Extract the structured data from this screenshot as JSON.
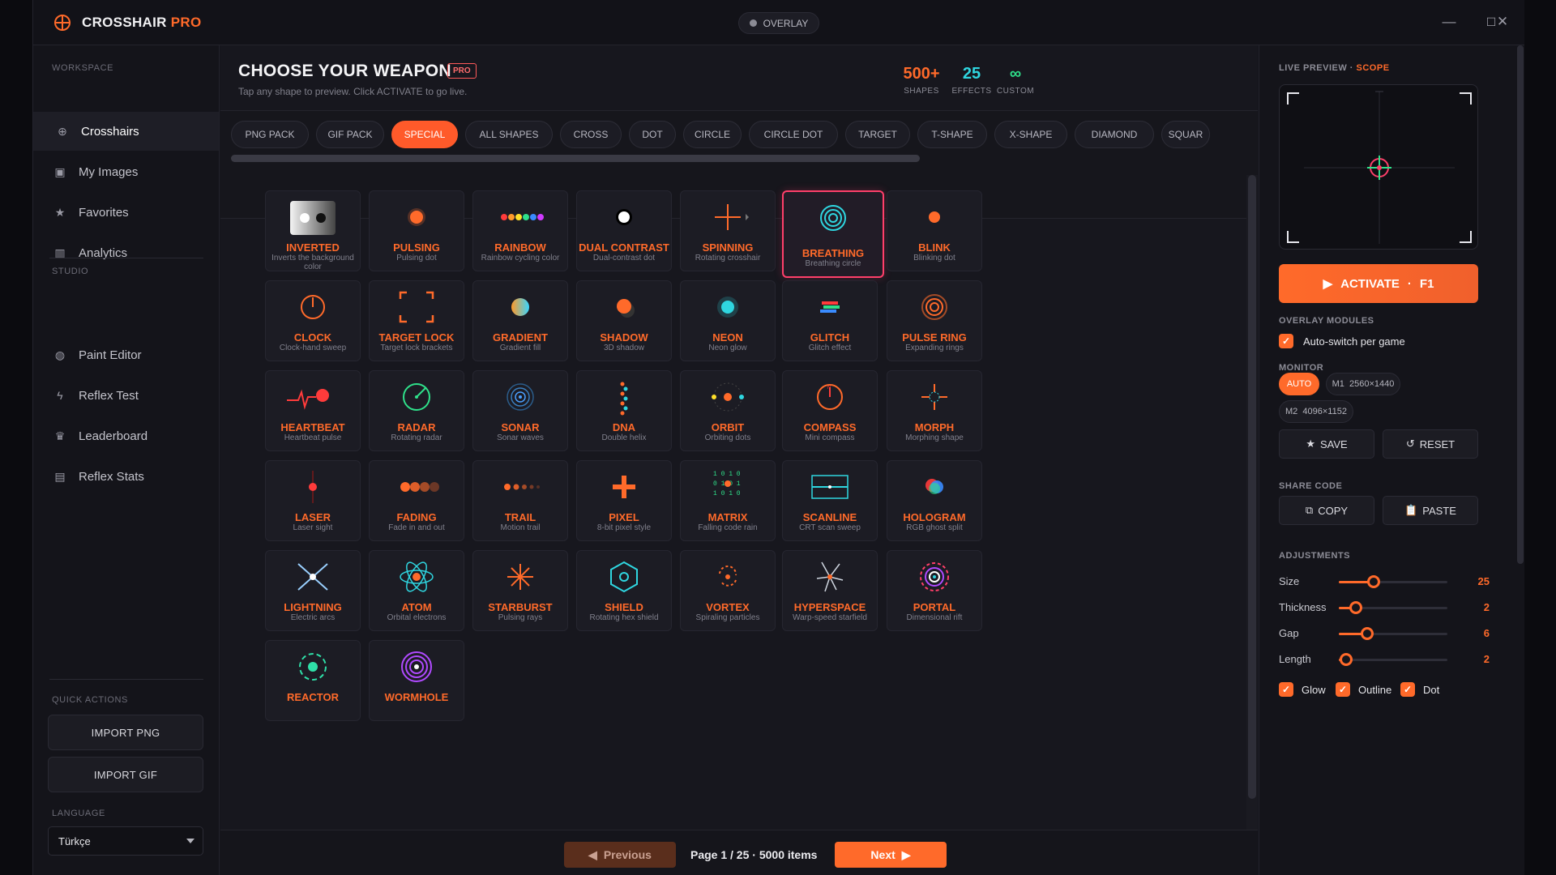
{
  "app": {
    "name": "CROSSHAIR",
    "name_accent": "PRO",
    "overlay_label": "OVERLAY"
  },
  "window_controls": {
    "minimize": "—",
    "maximize": "☐",
    "close": "✕"
  },
  "sidebar": {
    "workspace_label": "WORKSPACE",
    "studio_label": "STUDIO",
    "quick_actions_label": "QUICK ACTIONS",
    "language_label": "LANGUAGE",
    "items": [
      {
        "label": "Crosshairs",
        "icon": "crosshair-icon",
        "active": true
      },
      {
        "label": "My Images",
        "icon": "images-icon"
      },
      {
        "label": "Favorites",
        "icon": "star-icon"
      },
      {
        "label": "Analytics",
        "icon": "chart-icon"
      },
      {
        "label": "Paint Editor",
        "icon": "palette-icon"
      },
      {
        "label": "Reflex Test",
        "icon": "bolt-icon"
      },
      {
        "label": "Leaderboard",
        "icon": "trophy-icon"
      },
      {
        "label": "Reflex Stats",
        "icon": "stats-icon"
      }
    ],
    "import_png": "IMPORT PNG",
    "import_gif": "IMPORT GIF",
    "language": "Türkçe"
  },
  "main": {
    "title": "CHOOSE YOUR WEAPON",
    "badge": "PRO",
    "subtitle": "Tap any shape to preview. Click ACTIVATE to go live.",
    "stats": [
      {
        "num": "500+",
        "label": "SHAPES",
        "color": "#ff6a2a"
      },
      {
        "num": "25",
        "label": "EFFECTS",
        "color": "#2fd6e0"
      },
      {
        "num": "∞",
        "label": "CUSTOM",
        "color": "#2fe08a"
      }
    ],
    "tabs": [
      "PNG PACK",
      "GIF PACK",
      "SPECIAL",
      "ALL SHAPES",
      "CROSS",
      "DOT",
      "CIRCLE",
      "CIRCLE DOT",
      "TARGET",
      "T-SHAPE",
      "X-SHAPE",
      "DIAMOND",
      "SQUAR"
    ],
    "active_tab": "SPECIAL",
    "cards": [
      {
        "name": "INVERTED",
        "desc": "Inverts the background color",
        "icon": "inverted-icon"
      },
      {
        "name": "PULSING",
        "desc": "Pulsing dot",
        "icon": "pulse-dot-icon"
      },
      {
        "name": "RAINBOW",
        "desc": "Rainbow cycling color",
        "icon": "rainbow-dots-icon"
      },
      {
        "name": "DUAL CONTRAST",
        "desc": "Dual-contrast dot",
        "icon": "dual-dot-icon"
      },
      {
        "name": "SPINNING",
        "desc": "Rotating crosshair",
        "icon": "spin-cross-icon"
      },
      {
        "name": "BREATHING",
        "desc": "Breathing circle",
        "icon": "breathing-circle-icon",
        "active": true
      },
      {
        "name": "BLINK",
        "desc": "Blinking dot",
        "icon": "blink-dot-icon"
      },
      {
        "name": "CLOCK",
        "desc": "Clock-hand sweep",
        "icon": "clock-icon"
      },
      {
        "name": "TARGET LOCK",
        "desc": "Target lock brackets",
        "icon": "brackets-icon"
      },
      {
        "name": "GRADIENT",
        "desc": "Gradient fill",
        "icon": "gradient-dot-icon"
      },
      {
        "name": "SHADOW",
        "desc": "3D shadow",
        "icon": "shadow-dot-icon"
      },
      {
        "name": "NEON",
        "desc": "Neon glow",
        "icon": "neon-dot-icon"
      },
      {
        "name": "GLITCH",
        "desc": "Glitch effect",
        "icon": "glitch-icon"
      },
      {
        "name": "PULSE RING",
        "desc": "Expanding rings",
        "icon": "pulse-ring-icon"
      },
      {
        "name": "HEARTBEAT",
        "desc": "Heartbeat pulse",
        "icon": "heartbeat-icon"
      },
      {
        "name": "RADAR",
        "desc": "Rotating radar",
        "icon": "radar-icon"
      },
      {
        "name": "SONAR",
        "desc": "Sonar waves",
        "icon": "sonar-icon"
      },
      {
        "name": "DNA",
        "desc": "Double helix",
        "icon": "dna-icon"
      },
      {
        "name": "ORBIT",
        "desc": "Orbiting dots",
        "icon": "orbit-icon"
      },
      {
        "name": "COMPASS",
        "desc": "Mini compass",
        "icon": "compass-icon"
      },
      {
        "name": "MORPH",
        "desc": "Morphing shape",
        "icon": "morph-icon"
      },
      {
        "name": "LASER",
        "desc": "Laser sight",
        "icon": "laser-icon"
      },
      {
        "name": "FADING",
        "desc": "Fade in and out",
        "icon": "fading-dots-icon"
      },
      {
        "name": "TRAIL",
        "desc": "Motion trail",
        "icon": "trail-dots-icon"
      },
      {
        "name": "PIXEL",
        "desc": "8-bit pixel style",
        "icon": "pixel-cross-icon"
      },
      {
        "name": "MATRIX",
        "desc": "Falling code rain",
        "icon": "matrix-icon"
      },
      {
        "name": "SCANLINE",
        "desc": "CRT scan sweep",
        "icon": "scanline-icon"
      },
      {
        "name": "HOLOGRAM",
        "desc": "RGB ghost split",
        "icon": "hologram-icon"
      },
      {
        "name": "LIGHTNING",
        "desc": "Electric arcs",
        "icon": "lightning-icon"
      },
      {
        "name": "ATOM",
        "desc": "Orbital electrons",
        "icon": "atom-icon"
      },
      {
        "name": "STARBURST",
        "desc": "Pulsing rays",
        "icon": "starburst-icon"
      },
      {
        "name": "SHIELD",
        "desc": "Rotating hex shield",
        "icon": "hex-shield-icon"
      },
      {
        "name": "VORTEX",
        "desc": "Spiraling particles",
        "icon": "vortex-icon"
      },
      {
        "name": "HYPERSPACE",
        "desc": "Warp-speed starfield",
        "icon": "hyperspace-icon"
      },
      {
        "name": "PORTAL",
        "desc": "Dimensional rift",
        "icon": "portal-icon"
      },
      {
        "name": "REACTOR",
        "desc": "",
        "icon": "reactor-icon"
      },
      {
        "name": "WORMHOLE",
        "desc": "",
        "icon": "wormhole-icon"
      }
    ],
    "pager": {
      "prev": "Previous",
      "next": "Next",
      "page": "Page 1 / 25",
      "sep": "·",
      "items": "5000 items"
    }
  },
  "right": {
    "preview_label": "LIVE PREVIEW",
    "preview_mode": "SCOPE",
    "activate": "ACTIVATE",
    "activate_key": "F1",
    "modules_label": "OVERLAY MODULES",
    "auto_switch": "Auto-switch per game",
    "monitor_label": "MONITOR",
    "monitors": [
      {
        "label": "AUTO",
        "active": true
      },
      {
        "label": "M1  2560×1440"
      },
      {
        "label": "M2  4096×1152"
      }
    ],
    "save": "SAVE",
    "reset": "RESET",
    "share_label": "SHARE CODE",
    "copy": "COPY",
    "paste": "PASTE",
    "adjust_label": "ADJUSTMENTS",
    "adjustments": [
      {
        "label": "Size",
        "value": "25",
        "fraction": 0.32
      },
      {
        "label": "Thickness",
        "value": "2",
        "fraction": 0.16
      },
      {
        "label": "Gap",
        "value": "6",
        "fraction": 0.26
      },
      {
        "label": "Length",
        "value": "2",
        "fraction": 0.07
      }
    ],
    "toggles": [
      {
        "label": "Glow",
        "checked": true
      },
      {
        "label": "Outline",
        "checked": true
      },
      {
        "label": "Dot",
        "checked": true
      }
    ]
  },
  "colors": {
    "accent": "#ff6a2a",
    "active_card_border": "#ff3f6a"
  }
}
